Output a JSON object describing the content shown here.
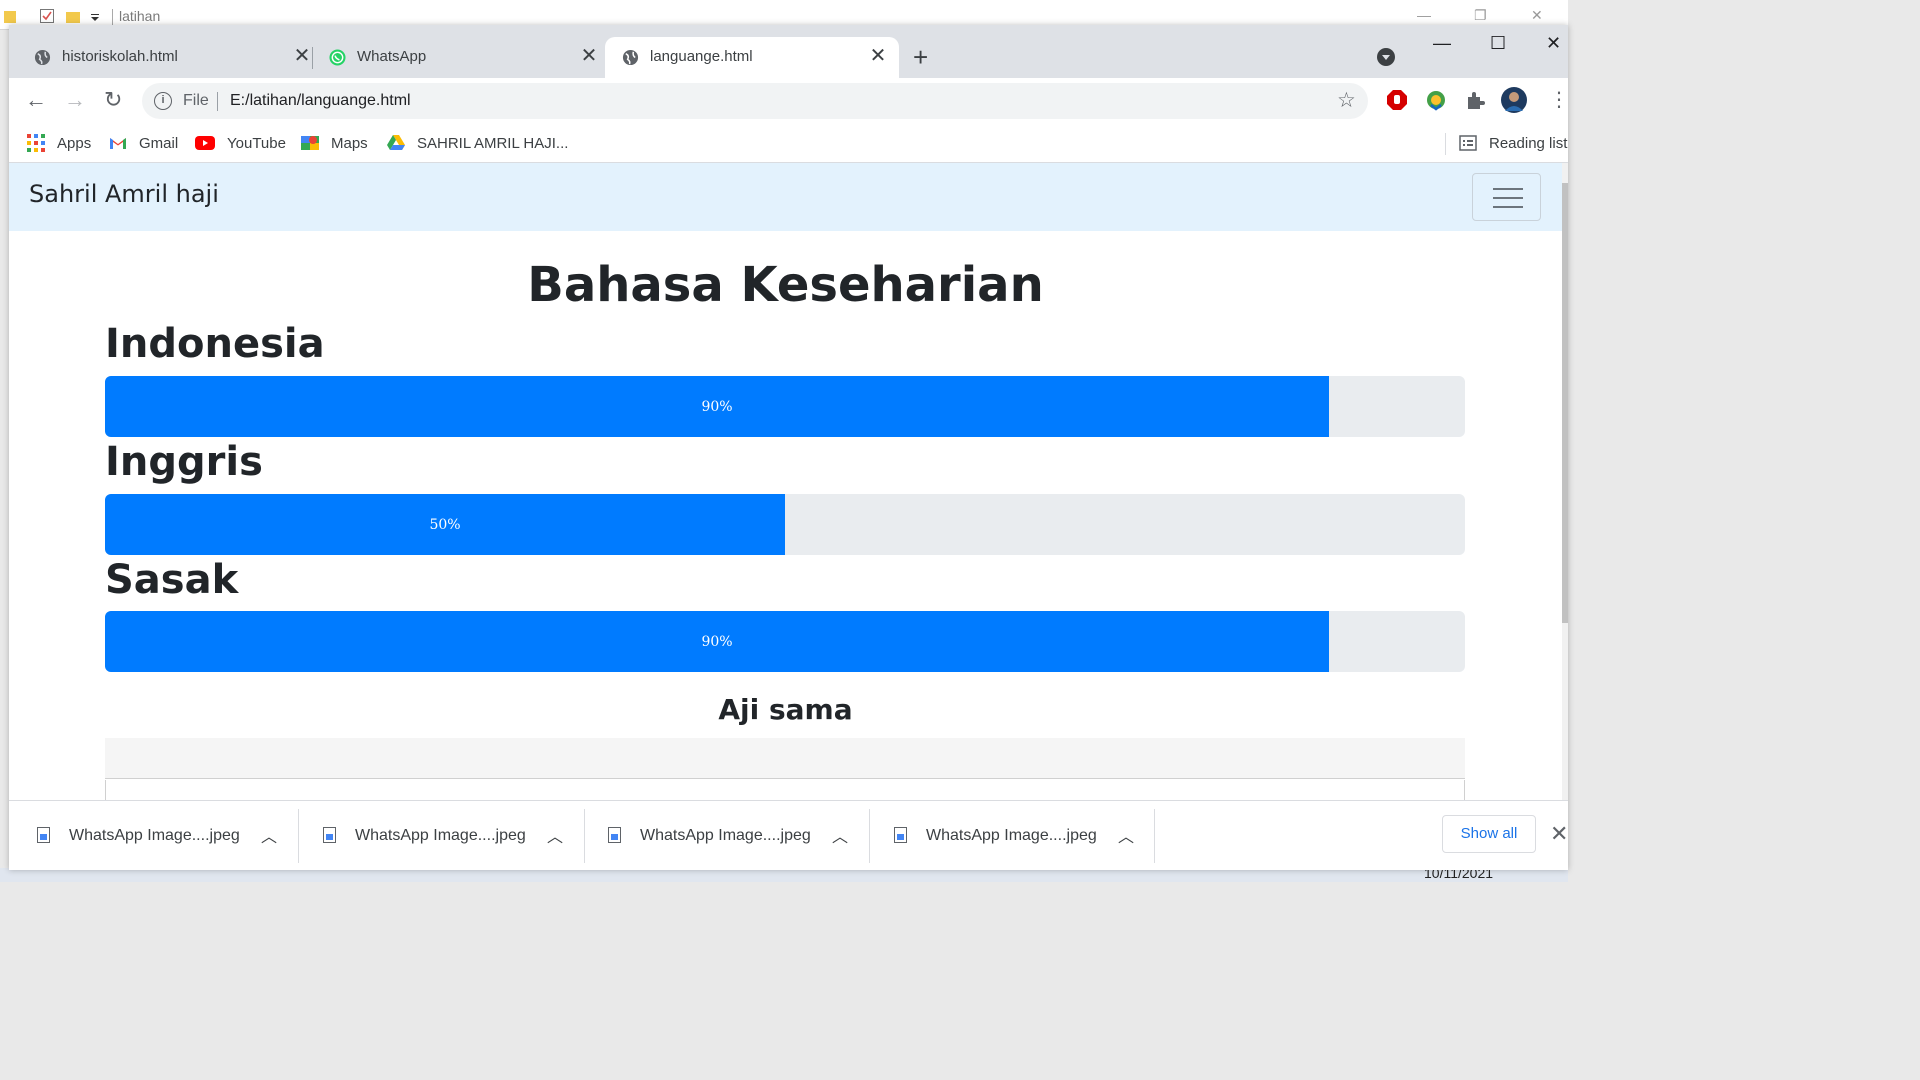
{
  "explorer": {
    "title": "latihan"
  },
  "tabs": [
    {
      "label": "historiskolah.html",
      "icon": "globe-icon"
    },
    {
      "label": "WhatsApp",
      "icon": "whatsapp-icon"
    },
    {
      "label": "languange.html",
      "icon": "globe-icon",
      "active": true
    }
  ],
  "omnibox": {
    "scheme": "File",
    "url": "E:/latihan/languange.html"
  },
  "bookmarks": [
    {
      "label": "Apps",
      "icon": "apps-grid-icon"
    },
    {
      "label": "Gmail",
      "icon": "gmail-icon"
    },
    {
      "label": "YouTube",
      "icon": "youtube-icon"
    },
    {
      "label": "Maps",
      "icon": "maps-icon"
    },
    {
      "label": "SAHRIL AMRIL HAJI...",
      "icon": "google-drive-icon"
    }
  ],
  "reading_list": "Reading list",
  "page": {
    "brand": "Sahril Amril haji",
    "heading": "Bahasa Keseharian",
    "languages": [
      {
        "name": "Indonesia",
        "percent": 90,
        "percent_label": "90%"
      },
      {
        "name": "Inggris",
        "percent": 50,
        "percent_label": "50%"
      },
      {
        "name": "Sasak",
        "percent": 90,
        "percent_label": "90%"
      }
    ],
    "subheading": "Aji sama"
  },
  "downloads": [
    {
      "name": "WhatsApp Image....jpeg"
    },
    {
      "name": "WhatsApp Image....jpeg"
    },
    {
      "name": "WhatsApp Image....jpeg"
    },
    {
      "name": "WhatsApp Image....jpeg"
    }
  ],
  "show_all": "Show all",
  "taskbar": {
    "date": "10/11/2021"
  },
  "colors": {
    "progress": "#007bff",
    "navbar": "#e3f2fd",
    "track": "#e9ecef"
  }
}
